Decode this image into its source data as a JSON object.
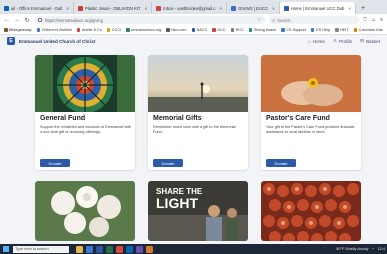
{
  "browser": {
    "tabs": [
      {
        "label": "ail - Office Emmanuel - Outl",
        "color": "#0a64b8"
      },
      {
        "label": "Plastic Jesus - OBLIVION KIT",
        "color": "#d23b3b"
      },
      {
        "label": "Inbox - eastbrooke@gmail.c",
        "color": "#c44"
      },
      {
        "label": "GIVING | EUCC",
        "color": "#3a6fc4"
      },
      {
        "label": "Home | Emmanuel UCC Dub",
        "color": "#2c5aa8",
        "active": true
      }
    ],
    "new_tab": "+",
    "url": "https://emmanuelucc.org/giving",
    "search_placeholder": "Search",
    "bookmarks": [
      {
        "label": "Biblegateway",
        "color": "#7b5a2e"
      },
      {
        "label": "Children's Bulletin",
        "color": "#3b7bd4"
      },
      {
        "label": "Arielle & Co",
        "color": "#c44"
      },
      {
        "label": "CCCI",
        "color": "#e8a200"
      },
      {
        "label": "emmanuelucc.org",
        "color": "#2c8a4b"
      },
      {
        "label": "hfcc.com",
        "color": "#555"
      },
      {
        "label": "NACC",
        "color": "#2c5aa8"
      },
      {
        "label": "UCC",
        "color": "#c44"
      },
      {
        "label": "RCC",
        "color": "#777"
      },
      {
        "label": "Sheng beach",
        "color": "#1a8f86"
      },
      {
        "label": "CS Support",
        "color": "#3b7bd4"
      },
      {
        "label": "CS Help",
        "color": "#3b7bd4"
      },
      {
        "label": "NEIT",
        "color": "#888"
      },
      {
        "label": "Columbia Gas",
        "color": "#e07b00"
      },
      {
        "label": "NetKid",
        "color": "#c44"
      },
      {
        "label": "Verse",
        "color": "#555"
      }
    ]
  },
  "site": {
    "logo_letter": "E",
    "name": "Emmanuel United Church of Christ",
    "nav": {
      "home": "Home",
      "profile": "Profile",
      "basket": "Basket"
    }
  },
  "cards": [
    {
      "title": "General Fund",
      "description": "Support the ministries and missions of Emmanuel with a one-time gift or recurring offerings.",
      "button": "Donate"
    },
    {
      "title": "Memorial Gifts",
      "description": "Remember loved ones with a gift to the Memorial Fund.",
      "button": "Donate"
    },
    {
      "title": "Pastor's Care Fund",
      "description": "Your gift to the Pastor's Care Fund provides financial assistance to local families in need.",
      "button": "Donate"
    }
  ],
  "lower_cards": [
    {
      "image": "white-roses"
    },
    {
      "image": "share-the-light",
      "overlay_line1": "SHARE THE",
      "overlay_line2": "LIGHT"
    },
    {
      "image": "red-pattern"
    }
  ],
  "taskbar": {
    "search_placeholder": "Type here to search",
    "weather": "50°F Mostly cloudy",
    "time": "12:4"
  },
  "colors": {
    "accent": "#2c5aa8",
    "taskbar": "#1d2738",
    "page_bg": "#f3f4f8"
  }
}
